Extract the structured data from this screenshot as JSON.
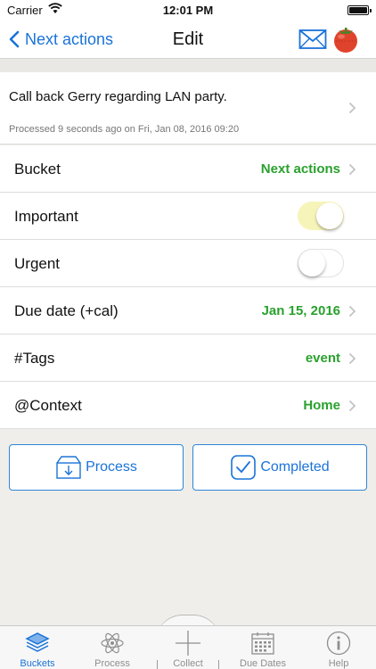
{
  "status_bar": {
    "carrier": "Carrier",
    "time": "12:01 PM"
  },
  "nav": {
    "back_label": "Next actions",
    "title": "Edit"
  },
  "task": {
    "title": "Call back Gerry regarding LAN party.",
    "meta": "Processed 9 seconds ago on Fri, Jan 08, 2016 09:20"
  },
  "rows": {
    "bucket": {
      "label": "Bucket",
      "value": "Next actions"
    },
    "important": {
      "label": "Important",
      "on": true
    },
    "urgent": {
      "label": "Urgent",
      "on": false
    },
    "due_date": {
      "label": "Due date (+cal)",
      "value": "Jan 15, 2016"
    },
    "tags": {
      "label": "#Tags",
      "value": "event"
    },
    "context": {
      "label": "@Context",
      "value": "Home"
    }
  },
  "actions": {
    "process_label": "Process",
    "completed_label": "Completed"
  },
  "tabs": [
    {
      "label": "Buckets",
      "icon": "stack-icon",
      "active": true
    },
    {
      "label": "Process",
      "icon": "atom-icon",
      "active": false
    },
    {
      "label": "Collect",
      "icon": "plus-icon",
      "active": false
    },
    {
      "label": "Due Dates",
      "icon": "calendar-icon",
      "active": false
    },
    {
      "label": "Help",
      "icon": "info-icon",
      "active": false
    }
  ],
  "colors": {
    "accent": "#1a73d9",
    "value_green": "#2aa12e",
    "toggle_on": "#f7f4b9"
  }
}
